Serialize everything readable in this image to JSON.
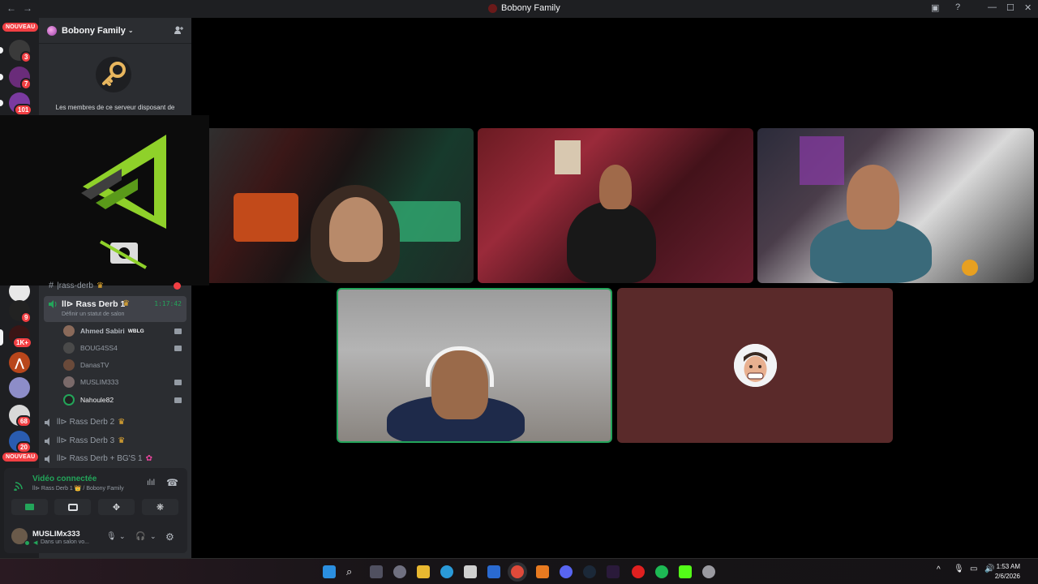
{
  "window": {
    "title": "Bobony Family",
    "nav_back": "←",
    "nav_fwd": "→"
  },
  "server": {
    "name": "Bobony Family",
    "permission_text": "Les membres de ce serveur disposant de"
  },
  "rail": {
    "badges": [
      "3",
      "7",
      "101",
      "9",
      "1K+",
      "68",
      "20"
    ],
    "new_label": "NOUVEAU"
  },
  "channels": {
    "partial": "|rass-derb",
    "active": {
      "name": "ll⊳ Rass Derb 1",
      "timer": "1:17:42",
      "status": "Définir un statut de salon"
    },
    "members": [
      {
        "name": "Ahmed Sabiri",
        "tag": "WBLG"
      },
      {
        "name": "BOUG4SS4"
      },
      {
        "name": "DanasTV"
      },
      {
        "name": "MUSLIM333"
      },
      {
        "name": "Nahoule82"
      }
    ],
    "others": [
      "ll⊳ Rass Derb 2",
      "ll⊳ Rass Derb 3",
      "ll⊳ Rass Derb + BG'S 1"
    ]
  },
  "voice": {
    "title": "Vidéo connectée",
    "subtitle": "ll⊳ Rass Derb 1 👑 / Bobony Family"
  },
  "user": {
    "name": "MUSLIMx333",
    "status": "Dans un salon vo..."
  },
  "taskbar": {
    "time": "1:53 AM",
    "date": "2/6/2026"
  },
  "colors": {
    "accent_green": "#23a55a",
    "red": "#f23f43",
    "tile_bg": "#5a2a2a"
  }
}
